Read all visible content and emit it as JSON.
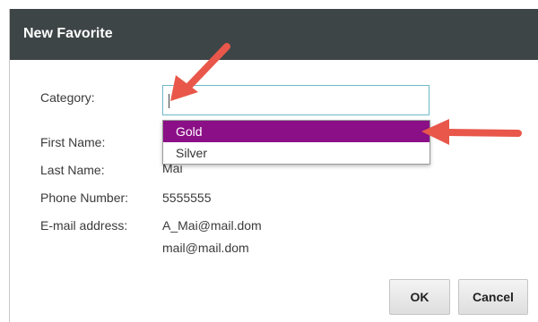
{
  "dialog": {
    "title": "New Favorite"
  },
  "form": {
    "category_label": "Category:",
    "category_value": "",
    "first_name_label": "First Name:",
    "last_name_label": "Last Name:",
    "last_name_value": "Mai",
    "phone_label": "Phone Number:",
    "phone_value": "5555555",
    "email_label": "E-mail address:",
    "email_values": [
      "A_Mai@mail.dom",
      "mail@mail.dom"
    ]
  },
  "dropdown": {
    "options": [
      "Gold",
      "Silver"
    ],
    "highlighted": "Gold"
  },
  "buttons": {
    "ok": "OK",
    "cancel": "Cancel"
  },
  "colors": {
    "titlebar": "#3e4547",
    "highlight": "#8b0f86",
    "focus_border": "#6fb9c9",
    "annotation_arrow": "#e8574a"
  }
}
